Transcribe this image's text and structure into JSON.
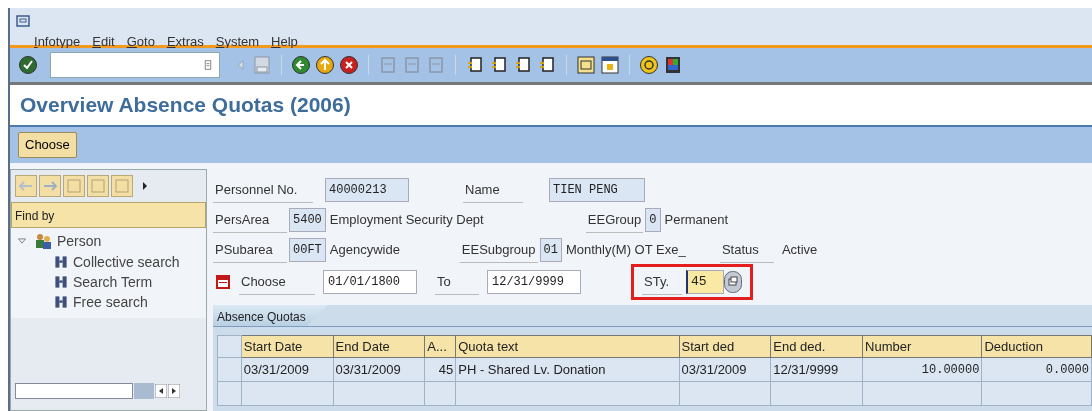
{
  "menu": [
    "Infotype",
    "Edit",
    "Goto",
    "Extras",
    "System",
    "Help"
  ],
  "title": "Overview Absence Quotas (2006)",
  "buttons": [
    "Choose"
  ],
  "navigator": {
    "find_by": "Find by",
    "tree": [
      {
        "label": "Person",
        "expanded": true,
        "children": [
          {
            "label": "Collective search"
          },
          {
            "label": "Search Term"
          },
          {
            "label": "Free search"
          }
        ]
      }
    ]
  },
  "header": {
    "personnel_no": {
      "label": "Personnel No.",
      "value": "40000213"
    },
    "name": {
      "label": "Name",
      "value": "TIEN PENG"
    },
    "pers_area": {
      "label": "PersArea",
      "value": "5400",
      "text": "Employment Security Dept"
    },
    "ee_group": {
      "label": "EEGroup",
      "value": "0",
      "text": "Permanent"
    },
    "p_subarea": {
      "label": "PSubarea",
      "value": "00FT",
      "text": "Agencywide"
    },
    "ee_subgroup": {
      "label": "EESubgroup",
      "value": "01",
      "text": "Monthly(M) OT Exe_"
    },
    "status": {
      "label": "Status",
      "text": "Active"
    },
    "choose": {
      "label": "Choose",
      "value": "01/01/1800"
    },
    "to": {
      "label": "To",
      "value": "12/31/9999"
    },
    "sty": {
      "label": "STy.",
      "value": "45",
      "highlighted": true
    }
  },
  "tabs": [
    {
      "label": "Absence Quotas",
      "selected": true
    }
  ],
  "table": {
    "columns": [
      "Start Date",
      "End Date",
      "A...",
      "Quota text",
      "Start ded",
      "End ded.",
      "Number",
      "Deduction"
    ],
    "rows": [
      [
        "03/31/2009",
        "03/31/2009",
        "45",
        "PH - Shared Lv. Donation",
        "03/31/2009",
        "12/31/9999",
        "10.00000",
        "0.0000"
      ]
    ]
  }
}
